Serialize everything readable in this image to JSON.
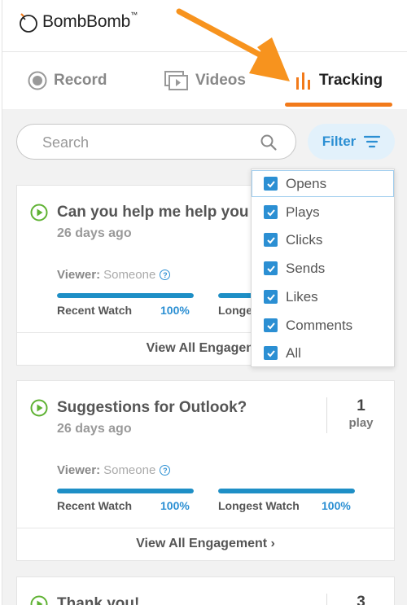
{
  "app": {
    "logo_text": "BombBomb",
    "logo_tm": "™"
  },
  "tabs": [
    {
      "label": "Record",
      "icon": "record-icon",
      "active": false
    },
    {
      "label": "Videos",
      "icon": "videos-icon",
      "active": false
    },
    {
      "label": "Tracking",
      "icon": "tracking-bars-icon",
      "active": true
    }
  ],
  "search": {
    "placeholder": "Search",
    "value": ""
  },
  "filter": {
    "button_label": "Filter",
    "options": [
      {
        "label": "Opens",
        "checked": true
      },
      {
        "label": "Plays",
        "checked": true
      },
      {
        "label": "Clicks",
        "checked": true
      },
      {
        "label": "Sends",
        "checked": true
      },
      {
        "label": "Likes",
        "checked": true
      },
      {
        "label": "Comments",
        "checked": true
      },
      {
        "label": "All",
        "checked": true
      }
    ]
  },
  "cards": [
    {
      "title": "Can you help me help you",
      "date": "26 days ago",
      "viewer_label": "Viewer:",
      "viewer_name": "Someone",
      "recent_label": "Recent Watch",
      "recent_pct": "100%",
      "recent_fraction": 1.0,
      "longest_label": "Longe",
      "longest_fraction": 1.0,
      "footer": "View All Engageme"
    },
    {
      "title": "Suggestions for Outlook?",
      "date": "26 days ago",
      "count": "1",
      "count_label": "play",
      "viewer_label": "Viewer:",
      "viewer_name": "Someone",
      "recent_label": "Recent Watch",
      "recent_pct": "100%",
      "recent_fraction": 1.0,
      "longest_label": "Longest Watch",
      "longest_pct": "100%",
      "longest_fraction": 1.0,
      "footer": "View All Engagement ›"
    },
    {
      "title": "Thank you!",
      "count": "3"
    }
  ],
  "colors": {
    "accent_blue": "#2b8fd3",
    "accent_orange": "#f27a1a",
    "play_green": "#5fb233",
    "arrow_orange": "#f7931e"
  }
}
